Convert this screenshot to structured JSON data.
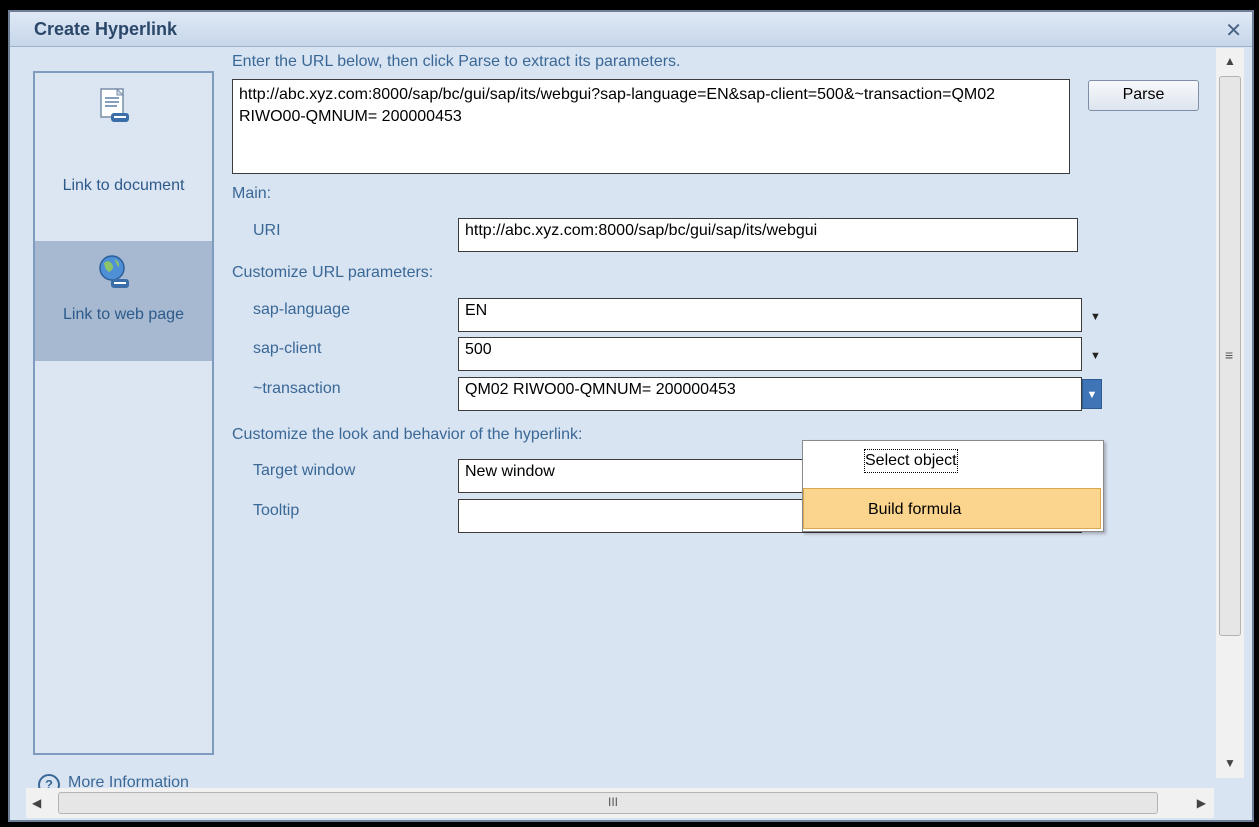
{
  "dialog": {
    "title": "Create Hyperlink",
    "close_glyph": "✕"
  },
  "sidebar": {
    "items": [
      {
        "label": "Link to document",
        "icon": "document-link-icon",
        "selected": false
      },
      {
        "label": "Link to web page",
        "icon": "web-link-icon",
        "selected": true
      }
    ]
  },
  "instructions": "Enter the URL below, then click Parse to extract its parameters.",
  "url_value": "http://abc.xyz.com:8000/sap/bc/gui/sap/its/webgui?sap-language=EN&sap-client=500&~transaction=QM02  RIWO00-QMNUM= 200000453",
  "parse_label": "Parse",
  "main": {
    "heading": "Main:",
    "uri_label": "URI",
    "uri_value": "http://abc.xyz.com:8000/sap/bc/gui/sap/its/webgui"
  },
  "params": {
    "heading": "Customize URL parameters:",
    "rows": [
      {
        "label": "sap-language",
        "value": "EN"
      },
      {
        "label": "sap-client",
        "value": "500"
      },
      {
        "label": "~transaction",
        "value": "QM02  RIWO00-QMNUM= 200000453"
      }
    ]
  },
  "look": {
    "heading": "Customize the look and behavior of the hyperlink:",
    "target_label": "Target window",
    "target_value": "New window",
    "tooltip_label": "Tooltip",
    "tooltip_value": ""
  },
  "dropdown_menu": {
    "items": [
      {
        "label": "Select object",
        "highlighted": false
      },
      {
        "label": "Build formula",
        "highlighted": true
      }
    ]
  },
  "footer": {
    "more_info": "More Information",
    "help_glyph": "?"
  },
  "scrollbar": {
    "grip_glyph": "≡",
    "h_grip_glyph": "III"
  },
  "colors": {
    "label_blue": "#3a6896",
    "menu_highlight": "#fbd48d",
    "title_text": "#2b4769"
  }
}
